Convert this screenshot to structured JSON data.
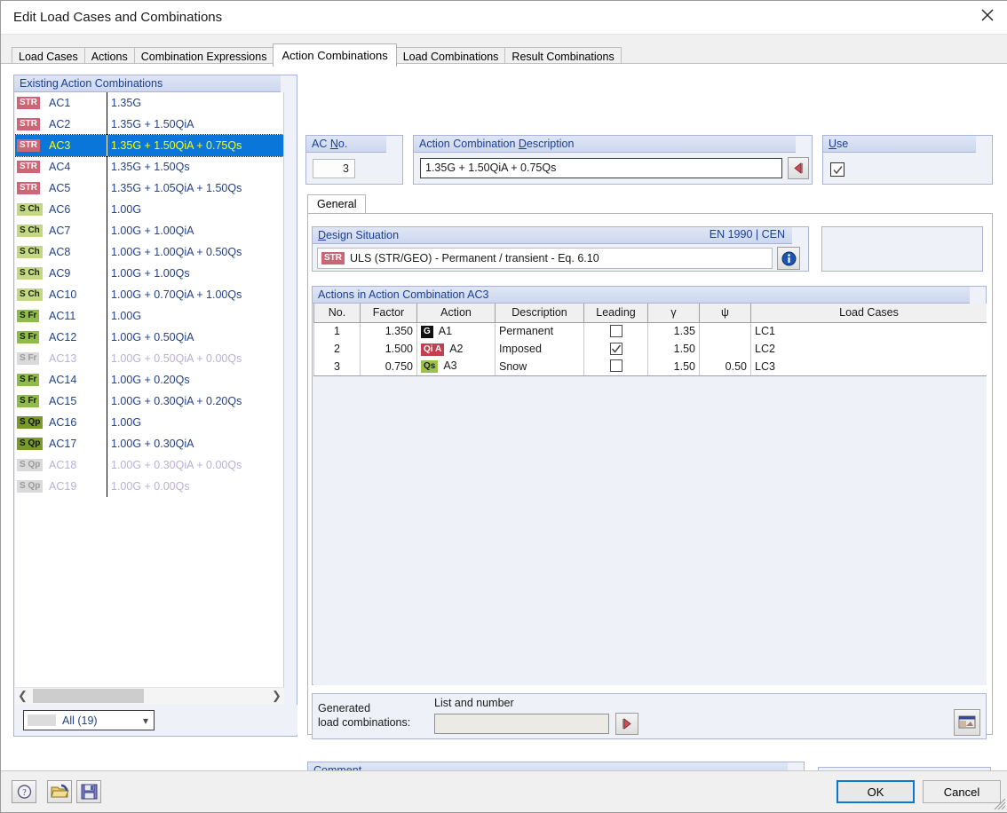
{
  "window": {
    "title": "Edit Load Cases and Combinations",
    "close_icon": "close-icon"
  },
  "tabs": [
    {
      "label": "Load Cases",
      "active": false
    },
    {
      "label": "Actions",
      "active": false
    },
    {
      "label": "Combination Expressions",
      "active": false
    },
    {
      "label": "Action Combinations",
      "active": true
    },
    {
      "label": "Load Combinations",
      "active": false
    },
    {
      "label": "Result Combinations",
      "active": false
    }
  ],
  "left_panel": {
    "title": "Existing Action Combinations",
    "rows": [
      {
        "badge": "STR",
        "badge_class": "str",
        "name": "AC1",
        "expr": "1.35G",
        "selected": false,
        "dimmed": false
      },
      {
        "badge": "STR",
        "badge_class": "str",
        "name": "AC2",
        "expr": "1.35G + 1.50QiA",
        "selected": false,
        "dimmed": false
      },
      {
        "badge": "STR",
        "badge_class": "str",
        "name": "AC3",
        "expr": "1.35G + 1.50QiA + 0.75Qs",
        "selected": true,
        "dimmed": false
      },
      {
        "badge": "STR",
        "badge_class": "str",
        "name": "AC4",
        "expr": "1.35G + 1.50Qs",
        "selected": false,
        "dimmed": false
      },
      {
        "badge": "STR",
        "badge_class": "str",
        "name": "AC5",
        "expr": "1.35G + 1.05QiA + 1.50Qs",
        "selected": false,
        "dimmed": false
      },
      {
        "badge": "S Ch",
        "badge_class": "sch",
        "name": "AC6",
        "expr": "1.00G",
        "selected": false,
        "dimmed": false
      },
      {
        "badge": "S Ch",
        "badge_class": "sch",
        "name": "AC7",
        "expr": "1.00G + 1.00QiA",
        "selected": false,
        "dimmed": false
      },
      {
        "badge": "S Ch",
        "badge_class": "sch",
        "name": "AC8",
        "expr": "1.00G + 1.00QiA + 0.50Qs",
        "selected": false,
        "dimmed": false
      },
      {
        "badge": "S Ch",
        "badge_class": "sch",
        "name": "AC9",
        "expr": "1.00G + 1.00Qs",
        "selected": false,
        "dimmed": false
      },
      {
        "badge": "S Ch",
        "badge_class": "sch",
        "name": "AC10",
        "expr": "1.00G + 0.70QiA + 1.00Qs",
        "selected": false,
        "dimmed": false
      },
      {
        "badge": "S Fr",
        "badge_class": "sfr",
        "name": "AC11",
        "expr": "1.00G",
        "selected": false,
        "dimmed": false
      },
      {
        "badge": "S Fr",
        "badge_class": "sfr",
        "name": "AC12",
        "expr": "1.00G + 0.50QiA",
        "selected": false,
        "dimmed": false
      },
      {
        "badge": "S Fr",
        "badge_class": "dim",
        "name": "AC13",
        "expr": "1.00G + 0.50QiA + 0.00Qs",
        "selected": false,
        "dimmed": true
      },
      {
        "badge": "S Fr",
        "badge_class": "sfr",
        "name": "AC14",
        "expr": "1.00G + 0.20Qs",
        "selected": false,
        "dimmed": false
      },
      {
        "badge": "S Fr",
        "badge_class": "sfr",
        "name": "AC15",
        "expr": "1.00G + 0.30QiA + 0.20Qs",
        "selected": false,
        "dimmed": false
      },
      {
        "badge": "S Qp",
        "badge_class": "sqp",
        "name": "AC16",
        "expr": "1.00G",
        "selected": false,
        "dimmed": false
      },
      {
        "badge": "S Qp",
        "badge_class": "sqp",
        "name": "AC17",
        "expr": "1.00G + 0.30QiA",
        "selected": false,
        "dimmed": false
      },
      {
        "badge": "S Qp",
        "badge_class": "dim",
        "name": "AC18",
        "expr": "1.00G + 0.30QiA + 0.00Qs",
        "selected": false,
        "dimmed": true
      },
      {
        "badge": "S Qp",
        "badge_class": "dim",
        "name": "AC19",
        "expr": "1.00G + 0.00Qs",
        "selected": false,
        "dimmed": true
      }
    ],
    "filter_value": "All (19)",
    "scroll_left_icon": "chevron-left-icon",
    "scroll_right_icon": "chevron-right-icon"
  },
  "ac_no": {
    "title_prefix": "AC ",
    "title_underline": "N",
    "title_suffix": "o.",
    "value": "3"
  },
  "description": {
    "title_prefix": "Action Combination ",
    "title_underline": "D",
    "title_suffix": "escription",
    "value": "1.35G + 1.50QiA + 0.75Qs",
    "button_icon": "red-left-arrow-icon"
  },
  "use": {
    "title_underline": "U",
    "title_suffix": "se",
    "checked": true
  },
  "inner_tab": {
    "label": "General"
  },
  "design_situation": {
    "title_underline": "D",
    "title_suffix": "esign Situation",
    "standard": "EN 1990 | CEN",
    "badge": "STR",
    "value": "ULS (STR/GEO) - Permanent / transient - Eq. 6.10",
    "info_icon": "info-icon"
  },
  "actions_table": {
    "title": "Actions in Action Combination AC3",
    "columns": [
      "No.",
      "Factor",
      "Action",
      "Description",
      "Leading",
      "γ",
      "ψ",
      "Load Cases"
    ],
    "rows": [
      {
        "no": "1",
        "factor": "1.350",
        "action_badge": "G",
        "action_badge_class": "g",
        "action": "A1",
        "description": "Permanent",
        "leading": false,
        "gamma": "1.35",
        "psi": "",
        "load_cases": "LC1"
      },
      {
        "no": "2",
        "factor": "1.500",
        "action_badge": "Qi A",
        "action_badge_class": "qia",
        "action": "A2",
        "description": "Imposed",
        "leading": true,
        "gamma": "1.50",
        "psi": "",
        "load_cases": "LC2"
      },
      {
        "no": "3",
        "factor": "0.750",
        "action_badge": "Qs",
        "action_badge_class": "qs",
        "action": "A3",
        "description": "Snow",
        "leading": false,
        "gamma": "1.50",
        "psi": "0.50",
        "load_cases": "LC3"
      }
    ]
  },
  "generated": {
    "label_line1": "Generated",
    "label_line2": "load combinations:",
    "sub_label": "List and number",
    "value": "",
    "go_icon": "red-right-arrow-icon",
    "right_icon": "table-view-icon"
  },
  "comment": {
    "title_underline": "C",
    "title_suffix": "omment",
    "value": "",
    "dropdown_icon": "chevron-down-icon",
    "copy_icon": "copy-icon"
  },
  "footer": {
    "help_icon": "help-icon",
    "open_icon": "open-folder-icon",
    "save_icon": "save-disk-icon",
    "ok_label": "OK",
    "cancel_label": "Cancel"
  }
}
